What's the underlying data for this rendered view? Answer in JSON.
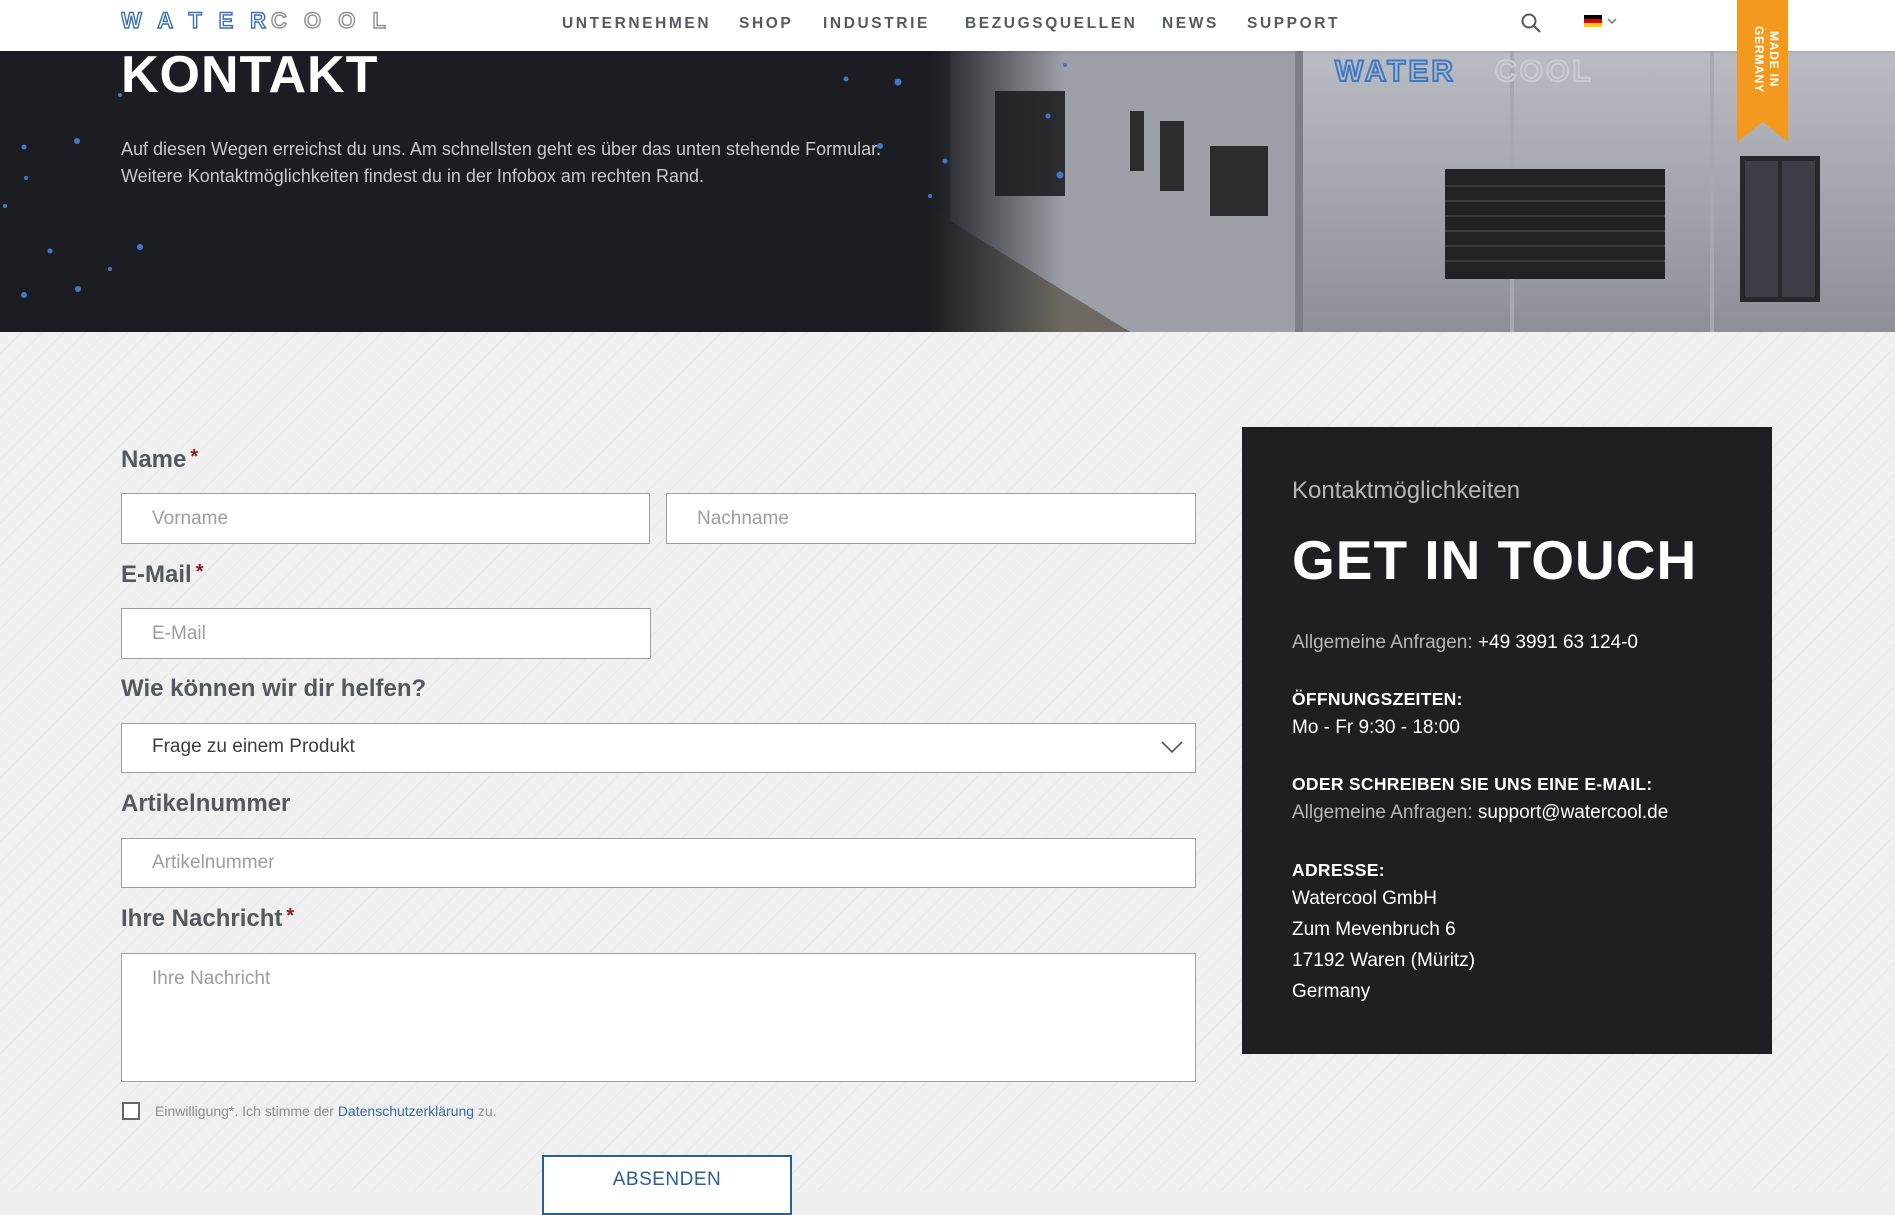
{
  "header": {
    "logo_alt": "WATERCOOL",
    "nav": [
      "UNTERNEHMEN",
      "SHOP",
      "INDUSTRIE",
      "BEZUGSQUELLEN",
      "NEWS",
      "SUPPORT"
    ],
    "ribbon_line1": "MADE IN",
    "ribbon_line2": "GERMANY",
    "colors": {
      "ribbon": "#f39a1e",
      "brand_blue": "#3a6fb0"
    }
  },
  "hero": {
    "title": "KONTAKT",
    "text_line1": "Auf diesen Wegen erreichst du uns. Am schnellsten geht es über das unten stehende Formular.",
    "text_line2": "Weitere Kontaktmöglichkeiten findest du in der Infobox am rechten Rand."
  },
  "form": {
    "name_label": "Name",
    "required_mark": "*",
    "firstname_placeholder": "Vorname",
    "lastname_placeholder": "Nachname",
    "email_label": "E-Mail",
    "email_placeholder": "E-Mail",
    "help_label": "Wie können wir dir helfen?",
    "help_selected": "Frage zu einem Produkt",
    "article_label": "Artikelnummer",
    "article_placeholder": "Artikelnummer",
    "message_label": "Ihre Nachricht",
    "message_placeholder": "Ihre Nachricht",
    "consent_text": "Einwilligung*. Ich stimme der ",
    "consent_link": "Datenschutzerklärung",
    "consent_after": " zu.",
    "submit_label": "ABSENDEN"
  },
  "infobox": {
    "subtitle": "Kontaktmöglichkeiten",
    "title": "GET IN TOUCH",
    "general_label": "Allgemeine Anfragen:",
    "phone": "+49 3991 63 124-0",
    "hours_head": "ÖFFNUNGSZEITEN:",
    "hours": "Mo - Fr  9:30  - 18:00",
    "email_head": "ODER SCHREIBEN SIE UNS EINE E-MAIL:",
    "email_label": "Allgemeine Anfragen:",
    "email": "support@watercool.de",
    "address_head": "ADRESSE:",
    "address": [
      "Watercool GmbH",
      "Zum Mevenbruch 6",
      "17192 Waren (Müritz)",
      "Germany"
    ]
  }
}
